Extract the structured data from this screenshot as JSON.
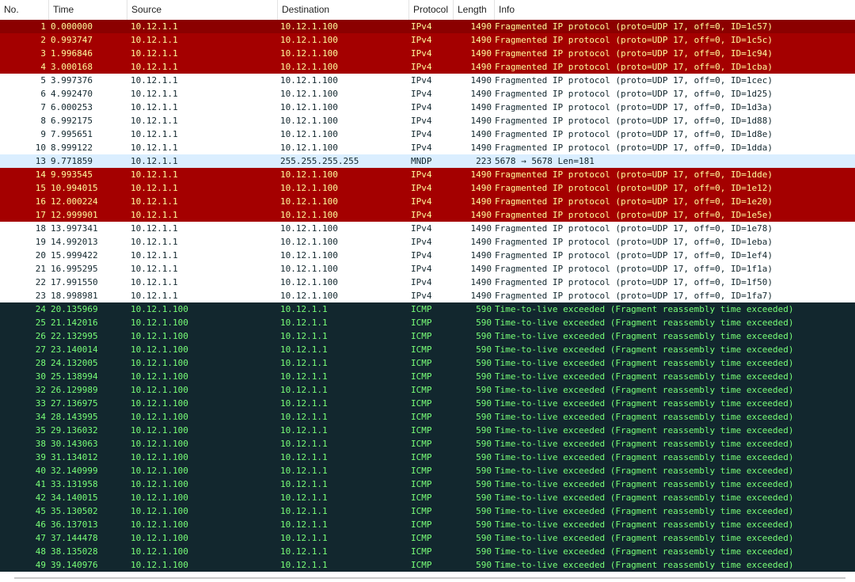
{
  "columns": {
    "no": "No.",
    "time": "Time",
    "source": "Source",
    "destination": "Destination",
    "protocol": "Protocol",
    "length": "Length",
    "info": "Info"
  },
  "colors": {
    "bad_bg": "#a40000",
    "bad_fg": "#fffc9c",
    "selected_bg": "#8b0000",
    "normal_bg": "#ffffff",
    "mndp_bg": "#daeeff",
    "icmp_bg": "#12272e",
    "icmp_fg": "#78ff78"
  },
  "rows": [
    {
      "no": "1",
      "time": "0.000000",
      "src": "10.12.1.1",
      "dst": "10.12.1.100",
      "proto": "IPv4",
      "len": "1490",
      "info": "Fragmented IP protocol (proto=UDP 17, off=0, ID=1c57)",
      "style": "first"
    },
    {
      "no": "2",
      "time": "0.993747",
      "src": "10.12.1.1",
      "dst": "10.12.1.100",
      "proto": "IPv4",
      "len": "1490",
      "info": "Fragmented IP protocol (proto=UDP 17, off=0, ID=1c5c)",
      "style": "bad"
    },
    {
      "no": "3",
      "time": "1.996846",
      "src": "10.12.1.1",
      "dst": "10.12.1.100",
      "proto": "IPv4",
      "len": "1490",
      "info": "Fragmented IP protocol (proto=UDP 17, off=0, ID=1c94)",
      "style": "bad"
    },
    {
      "no": "4",
      "time": "3.000168",
      "src": "10.12.1.1",
      "dst": "10.12.1.100",
      "proto": "IPv4",
      "len": "1490",
      "info": "Fragmented IP protocol (proto=UDP 17, off=0, ID=1cba)",
      "style": "bad"
    },
    {
      "no": "5",
      "time": "3.997376",
      "src": "10.12.1.1",
      "dst": "10.12.1.100",
      "proto": "IPv4",
      "len": "1490",
      "info": "Fragmented IP protocol (proto=UDP 17, off=0, ID=1cec)",
      "style": "normal"
    },
    {
      "no": "6",
      "time": "4.992470",
      "src": "10.12.1.1",
      "dst": "10.12.1.100",
      "proto": "IPv4",
      "len": "1490",
      "info": "Fragmented IP protocol (proto=UDP 17, off=0, ID=1d25)",
      "style": "normal"
    },
    {
      "no": "7",
      "time": "6.000253",
      "src": "10.12.1.1",
      "dst": "10.12.1.100",
      "proto": "IPv4",
      "len": "1490",
      "info": "Fragmented IP protocol (proto=UDP 17, off=0, ID=1d3a)",
      "style": "normal"
    },
    {
      "no": "8",
      "time": "6.992175",
      "src": "10.12.1.1",
      "dst": "10.12.1.100",
      "proto": "IPv4",
      "len": "1490",
      "info": "Fragmented IP protocol (proto=UDP 17, off=0, ID=1d88)",
      "style": "normal"
    },
    {
      "no": "9",
      "time": "7.995651",
      "src": "10.12.1.1",
      "dst": "10.12.1.100",
      "proto": "IPv4",
      "len": "1490",
      "info": "Fragmented IP protocol (proto=UDP 17, off=0, ID=1d8e)",
      "style": "normal"
    },
    {
      "no": "10",
      "time": "8.999122",
      "src": "10.12.1.1",
      "dst": "10.12.1.100",
      "proto": "IPv4",
      "len": "1490",
      "info": "Fragmented IP protocol (proto=UDP 17, off=0, ID=1dda)",
      "style": "normal"
    },
    {
      "no": "13",
      "time": "9.771859",
      "src": "10.12.1.1",
      "dst": "255.255.255.255",
      "proto": "MNDP",
      "len": "223",
      "info": "5678 → 5678 Len=181",
      "style": "mndp"
    },
    {
      "no": "14",
      "time": "9.993545",
      "src": "10.12.1.1",
      "dst": "10.12.1.100",
      "proto": "IPv4",
      "len": "1490",
      "info": "Fragmented IP protocol (proto=UDP 17, off=0, ID=1dde)",
      "style": "bad"
    },
    {
      "no": "15",
      "time": "10.994015",
      "src": "10.12.1.1",
      "dst": "10.12.1.100",
      "proto": "IPv4",
      "len": "1490",
      "info": "Fragmented IP protocol (proto=UDP 17, off=0, ID=1e12)",
      "style": "bad"
    },
    {
      "no": "16",
      "time": "12.000224",
      "src": "10.12.1.1",
      "dst": "10.12.1.100",
      "proto": "IPv4",
      "len": "1490",
      "info": "Fragmented IP protocol (proto=UDP 17, off=0, ID=1e20)",
      "style": "bad"
    },
    {
      "no": "17",
      "time": "12.999901",
      "src": "10.12.1.1",
      "dst": "10.12.1.100",
      "proto": "IPv4",
      "len": "1490",
      "info": "Fragmented IP protocol (proto=UDP 17, off=0, ID=1e5e)",
      "style": "bad"
    },
    {
      "no": "18",
      "time": "13.997341",
      "src": "10.12.1.1",
      "dst": "10.12.1.100",
      "proto": "IPv4",
      "len": "1490",
      "info": "Fragmented IP protocol (proto=UDP 17, off=0, ID=1e78)",
      "style": "normal"
    },
    {
      "no": "19",
      "time": "14.992013",
      "src": "10.12.1.1",
      "dst": "10.12.1.100",
      "proto": "IPv4",
      "len": "1490",
      "info": "Fragmented IP protocol (proto=UDP 17, off=0, ID=1eba)",
      "style": "normal"
    },
    {
      "no": "20",
      "time": "15.999422",
      "src": "10.12.1.1",
      "dst": "10.12.1.100",
      "proto": "IPv4",
      "len": "1490",
      "info": "Fragmented IP protocol (proto=UDP 17, off=0, ID=1ef4)",
      "style": "normal"
    },
    {
      "no": "21",
      "time": "16.995295",
      "src": "10.12.1.1",
      "dst": "10.12.1.100",
      "proto": "IPv4",
      "len": "1490",
      "info": "Fragmented IP protocol (proto=UDP 17, off=0, ID=1f1a)",
      "style": "normal"
    },
    {
      "no": "22",
      "time": "17.991550",
      "src": "10.12.1.1",
      "dst": "10.12.1.100",
      "proto": "IPv4",
      "len": "1490",
      "info": "Fragmented IP protocol (proto=UDP 17, off=0, ID=1f50)",
      "style": "normal"
    },
    {
      "no": "23",
      "time": "18.998981",
      "src": "10.12.1.1",
      "dst": "10.12.1.100",
      "proto": "IPv4",
      "len": "1490",
      "info": "Fragmented IP protocol (proto=UDP 17, off=0, ID=1fa7)",
      "style": "normal"
    },
    {
      "no": "24",
      "time": "20.135969",
      "src": "10.12.1.100",
      "dst": "10.12.1.1",
      "proto": "ICMP",
      "len": "590",
      "info": "Time-to-live exceeded (Fragment reassembly time exceeded)",
      "style": "icmp"
    },
    {
      "no": "25",
      "time": "21.142016",
      "src": "10.12.1.100",
      "dst": "10.12.1.1",
      "proto": "ICMP",
      "len": "590",
      "info": "Time-to-live exceeded (Fragment reassembly time exceeded)",
      "style": "icmp"
    },
    {
      "no": "26",
      "time": "22.132995",
      "src": "10.12.1.100",
      "dst": "10.12.1.1",
      "proto": "ICMP",
      "len": "590",
      "info": "Time-to-live exceeded (Fragment reassembly time exceeded)",
      "style": "icmp"
    },
    {
      "no": "27",
      "time": "23.140014",
      "src": "10.12.1.100",
      "dst": "10.12.1.1",
      "proto": "ICMP",
      "len": "590",
      "info": "Time-to-live exceeded (Fragment reassembly time exceeded)",
      "style": "icmp"
    },
    {
      "no": "28",
      "time": "24.132005",
      "src": "10.12.1.100",
      "dst": "10.12.1.1",
      "proto": "ICMP",
      "len": "590",
      "info": "Time-to-live exceeded (Fragment reassembly time exceeded)",
      "style": "icmp"
    },
    {
      "no": "30",
      "time": "25.138994",
      "src": "10.12.1.100",
      "dst": "10.12.1.1",
      "proto": "ICMP",
      "len": "590",
      "info": "Time-to-live exceeded (Fragment reassembly time exceeded)",
      "style": "icmp"
    },
    {
      "no": "32",
      "time": "26.129989",
      "src": "10.12.1.100",
      "dst": "10.12.1.1",
      "proto": "ICMP",
      "len": "590",
      "info": "Time-to-live exceeded (Fragment reassembly time exceeded)",
      "style": "icmp"
    },
    {
      "no": "33",
      "time": "27.136975",
      "src": "10.12.1.100",
      "dst": "10.12.1.1",
      "proto": "ICMP",
      "len": "590",
      "info": "Time-to-live exceeded (Fragment reassembly time exceeded)",
      "style": "icmp"
    },
    {
      "no": "34",
      "time": "28.143995",
      "src": "10.12.1.100",
      "dst": "10.12.1.1",
      "proto": "ICMP",
      "len": "590",
      "info": "Time-to-live exceeded (Fragment reassembly time exceeded)",
      "style": "icmp"
    },
    {
      "no": "35",
      "time": "29.136032",
      "src": "10.12.1.100",
      "dst": "10.12.1.1",
      "proto": "ICMP",
      "len": "590",
      "info": "Time-to-live exceeded (Fragment reassembly time exceeded)",
      "style": "icmp"
    },
    {
      "no": "38",
      "time": "30.143063",
      "src": "10.12.1.100",
      "dst": "10.12.1.1",
      "proto": "ICMP",
      "len": "590",
      "info": "Time-to-live exceeded (Fragment reassembly time exceeded)",
      "style": "icmp"
    },
    {
      "no": "39",
      "time": "31.134012",
      "src": "10.12.1.100",
      "dst": "10.12.1.1",
      "proto": "ICMP",
      "len": "590",
      "info": "Time-to-live exceeded (Fragment reassembly time exceeded)",
      "style": "icmp"
    },
    {
      "no": "40",
      "time": "32.140999",
      "src": "10.12.1.100",
      "dst": "10.12.1.1",
      "proto": "ICMP",
      "len": "590",
      "info": "Time-to-live exceeded (Fragment reassembly time exceeded)",
      "style": "icmp"
    },
    {
      "no": "41",
      "time": "33.131958",
      "src": "10.12.1.100",
      "dst": "10.12.1.1",
      "proto": "ICMP",
      "len": "590",
      "info": "Time-to-live exceeded (Fragment reassembly time exceeded)",
      "style": "icmp"
    },
    {
      "no": "42",
      "time": "34.140015",
      "src": "10.12.1.100",
      "dst": "10.12.1.1",
      "proto": "ICMP",
      "len": "590",
      "info": "Time-to-live exceeded (Fragment reassembly time exceeded)",
      "style": "icmp"
    },
    {
      "no": "45",
      "time": "35.130502",
      "src": "10.12.1.100",
      "dst": "10.12.1.1",
      "proto": "ICMP",
      "len": "590",
      "info": "Time-to-live exceeded (Fragment reassembly time exceeded)",
      "style": "icmp"
    },
    {
      "no": "46",
      "time": "36.137013",
      "src": "10.12.1.100",
      "dst": "10.12.1.1",
      "proto": "ICMP",
      "len": "590",
      "info": "Time-to-live exceeded (Fragment reassembly time exceeded)",
      "style": "icmp"
    },
    {
      "no": "47",
      "time": "37.144478",
      "src": "10.12.1.100",
      "dst": "10.12.1.1",
      "proto": "ICMP",
      "len": "590",
      "info": "Time-to-live exceeded (Fragment reassembly time exceeded)",
      "style": "icmp"
    },
    {
      "no": "48",
      "time": "38.135028",
      "src": "10.12.1.100",
      "dst": "10.12.1.1",
      "proto": "ICMP",
      "len": "590",
      "info": "Time-to-live exceeded (Fragment reassembly time exceeded)",
      "style": "icmp"
    },
    {
      "no": "49",
      "time": "39.140976",
      "src": "10.12.1.100",
      "dst": "10.12.1.1",
      "proto": "ICMP",
      "len": "590",
      "info": "Time-to-live exceeded (Fragment reassembly time exceeded)",
      "style": "icmp"
    }
  ]
}
